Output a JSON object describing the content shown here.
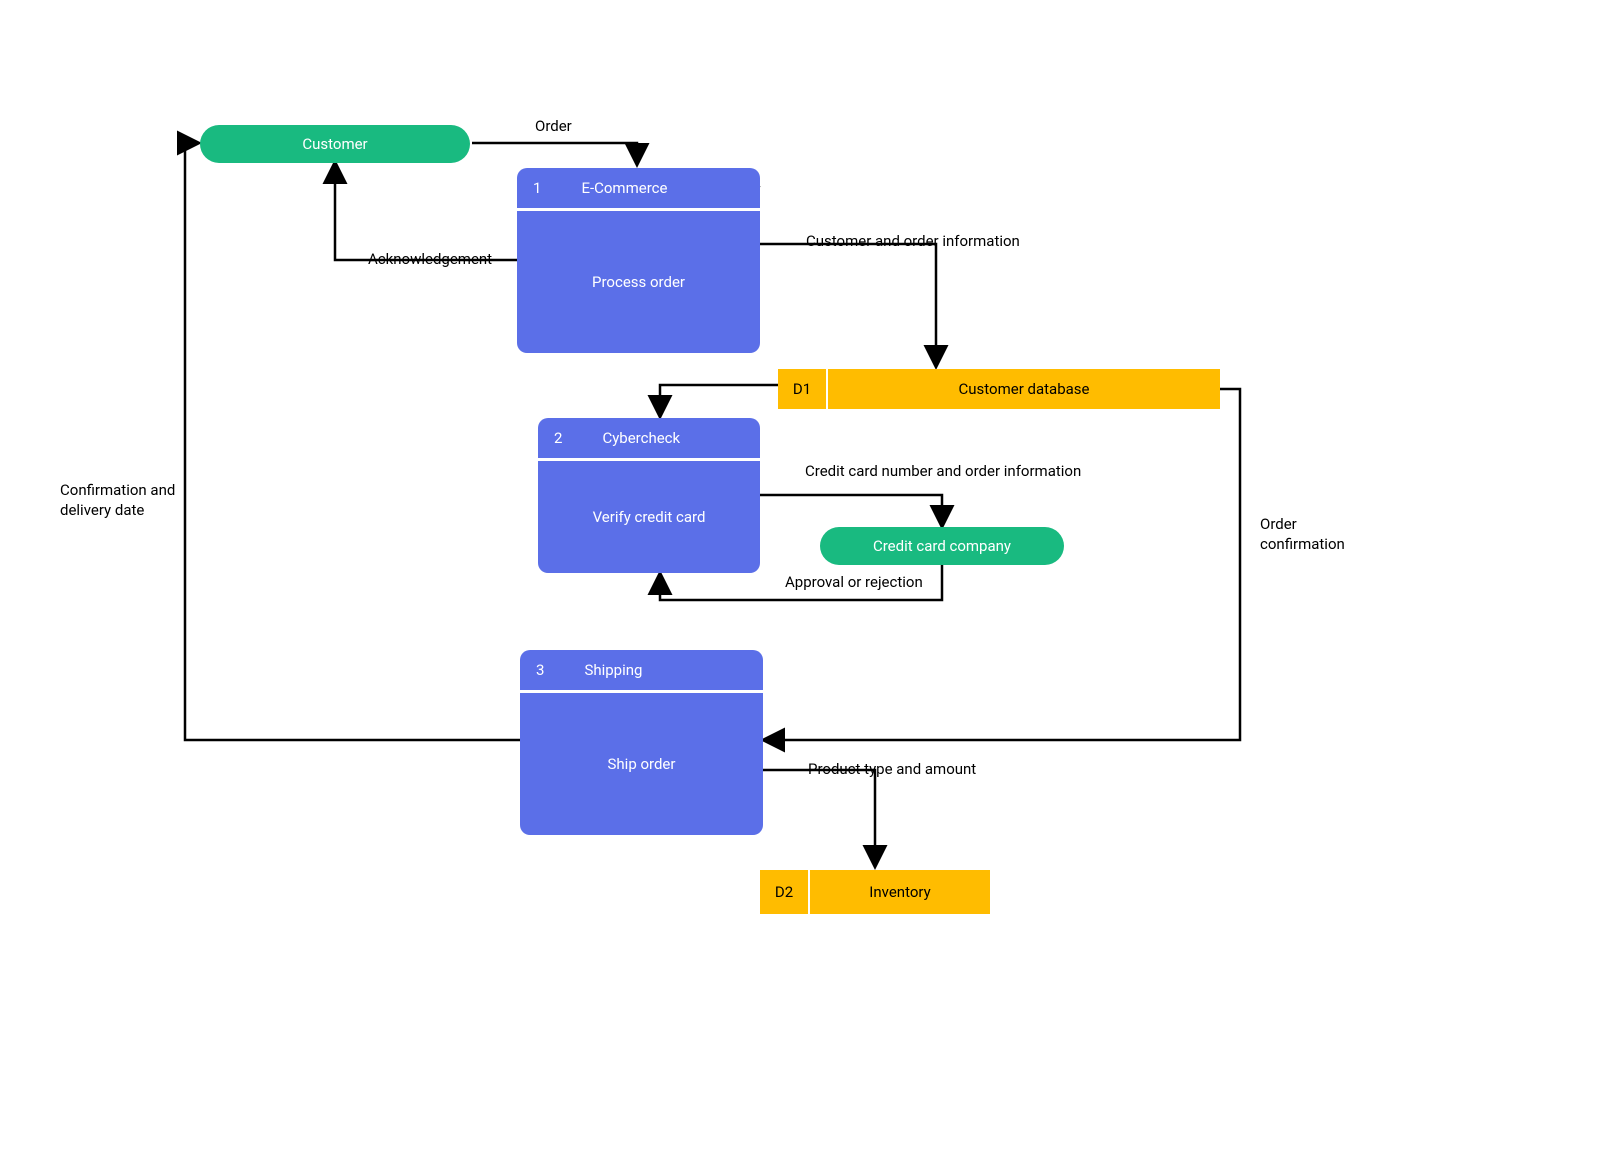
{
  "entities": {
    "customer": "Customer",
    "credit_card_company": "Credit card company"
  },
  "processes": {
    "p1": {
      "num": "1",
      "title": "E-Commerce",
      "body": "Process order"
    },
    "p2": {
      "num": "2",
      "title": "Cybercheck",
      "body": "Verify credit card"
    },
    "p3": {
      "num": "3",
      "title": "Shipping",
      "body": "Ship order"
    }
  },
  "datastores": {
    "d1": {
      "id": "D1",
      "label": "Customer database"
    },
    "d2": {
      "id": "D2",
      "label": "Inventory"
    }
  },
  "flows": {
    "order": "Order",
    "acknowledgement": "Acknowledgement",
    "customer_order_info": "Customer and order information",
    "cc_number_order_info": "Credit card number and order information",
    "approval_rejection": "Approval or rejection",
    "order_confirmation": "Order\nconfirmation",
    "product_amount": "Product type and amount",
    "confirmation_delivery": "Confirmation and\ndelivery date"
  }
}
